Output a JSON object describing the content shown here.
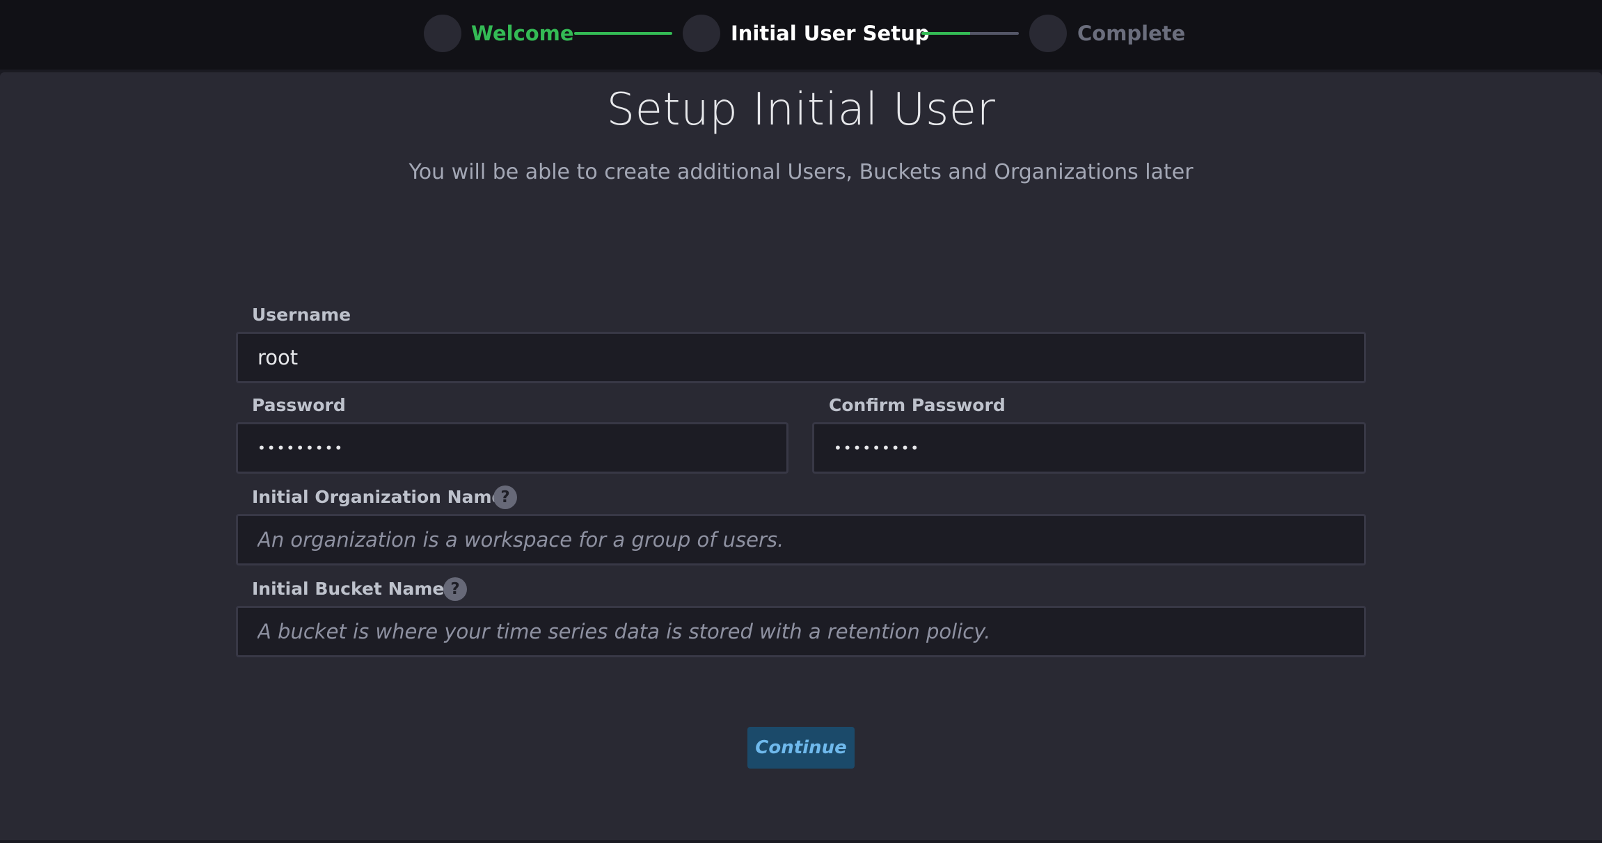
{
  "stepper": {
    "steps": [
      {
        "label": "Welcome",
        "state": "done",
        "color": "#34bb55"
      },
      {
        "label": "Initial User Setup",
        "state": "current",
        "color": "#ffffff"
      },
      {
        "label": "Complete",
        "state": "pending",
        "color": "#6b6e7d"
      }
    ],
    "connectors": [
      {
        "progress": 1.0
      },
      {
        "progress": 0.5
      }
    ]
  },
  "page": {
    "title": "Setup Initial User",
    "subtitle": "You will be able to create additional Users, Buckets and Organizations later"
  },
  "form": {
    "username": {
      "label": "Username",
      "value": "root"
    },
    "password": {
      "label": "Password",
      "value": "•••••••••"
    },
    "confirm_password": {
      "label": "Confirm Password",
      "value": "•••••••••"
    },
    "organization": {
      "label": "Initial Organization Name",
      "value": "",
      "placeholder": "An organization is a workspace for a group of users.",
      "help_icon": "question-mark",
      "help_glyph": "?"
    },
    "bucket": {
      "label": "Initial Bucket Name",
      "value": "",
      "placeholder": "A bucket is where your time series data is stored with a retention policy.",
      "help_icon": "question-mark",
      "help_glyph": "?"
    }
  },
  "actions": {
    "continue_label": "Continue"
  },
  "colors": {
    "accent_green": "#34bb55",
    "primary_button": "#1b4a6a",
    "primary_button_text": "#6fb9ec",
    "panel": "#292933",
    "header": "#111116"
  }
}
